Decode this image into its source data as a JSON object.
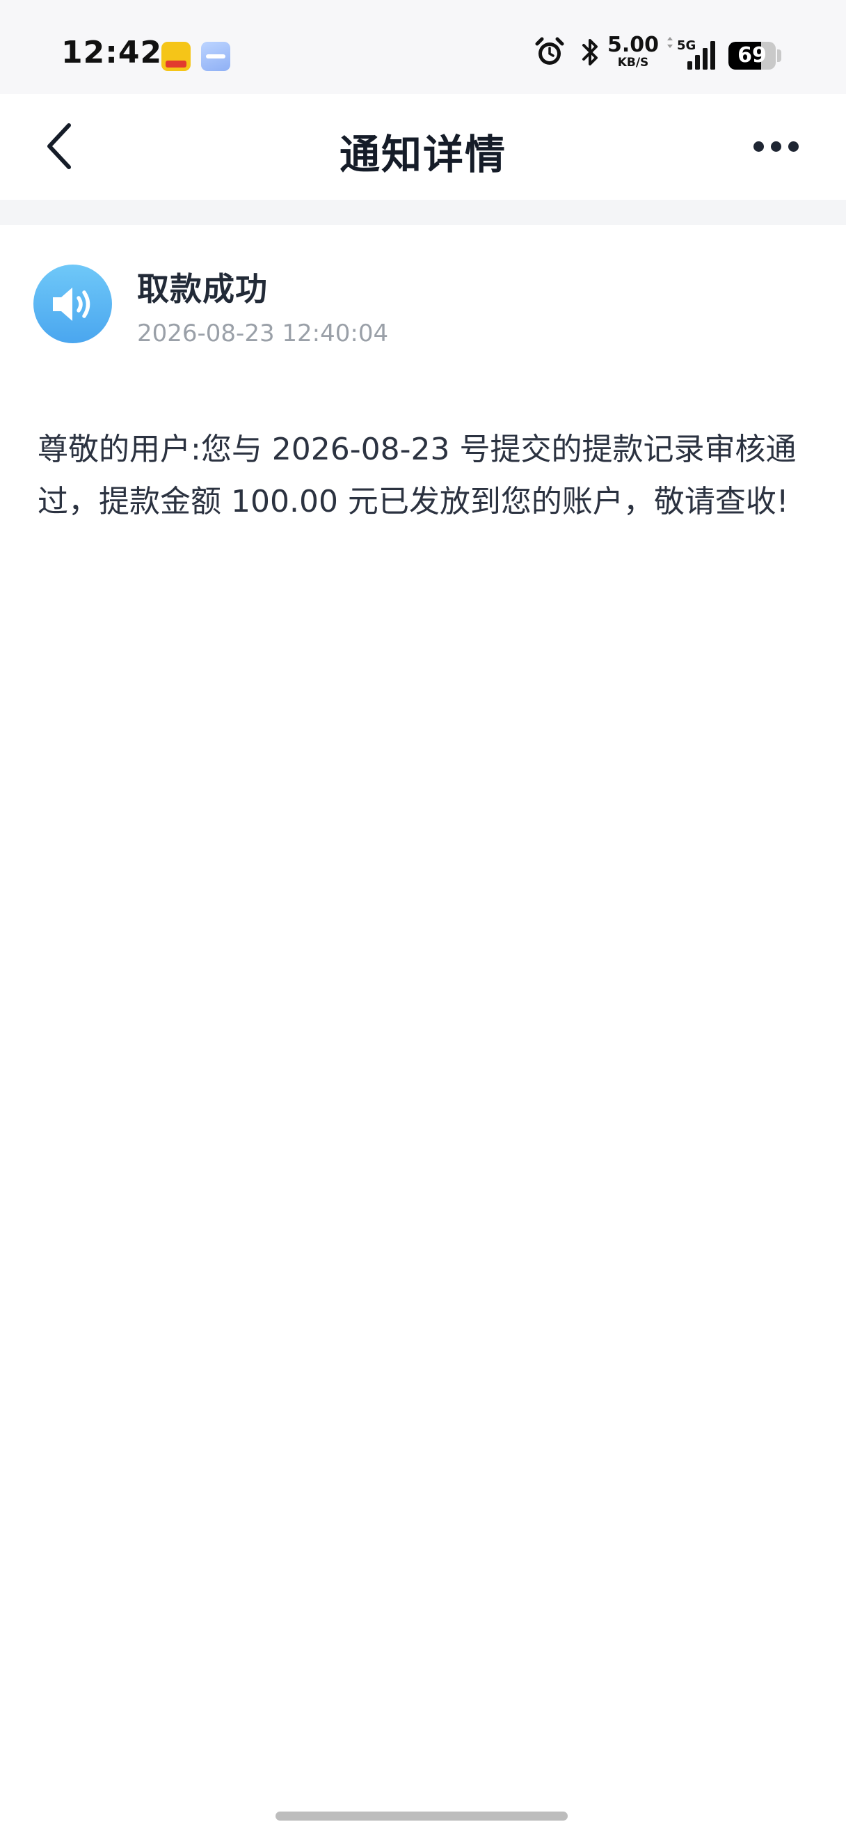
{
  "status_bar": {
    "time": "12:42",
    "net_speed_value": "5.00",
    "net_speed_unit": "KB/S",
    "network_type": "5G",
    "battery_level": "69",
    "icons": [
      "app-badge-icon",
      "app-badge-icon",
      "alarm-icon",
      "bluetooth-icon",
      "signal-icon",
      "battery-icon"
    ]
  },
  "nav": {
    "title": "通知详情",
    "back_icon": "chevron-left-icon",
    "more_icon": "more-dots-icon"
  },
  "notice": {
    "icon": "speaker-icon",
    "title": "取款成功",
    "time": "2026-08-23 12:40:04",
    "body": "尊敬的用户:您与 2026-08-23 号提交的提款记录审核通过，提款金额 100.00 元已发放到您的账户，敬请查收!"
  },
  "colors": {
    "accent_blue": "#4aa6ef",
    "title_text": "#151c28",
    "secondary_text": "#9aa0a8",
    "divider": "#f4f5f7"
  }
}
